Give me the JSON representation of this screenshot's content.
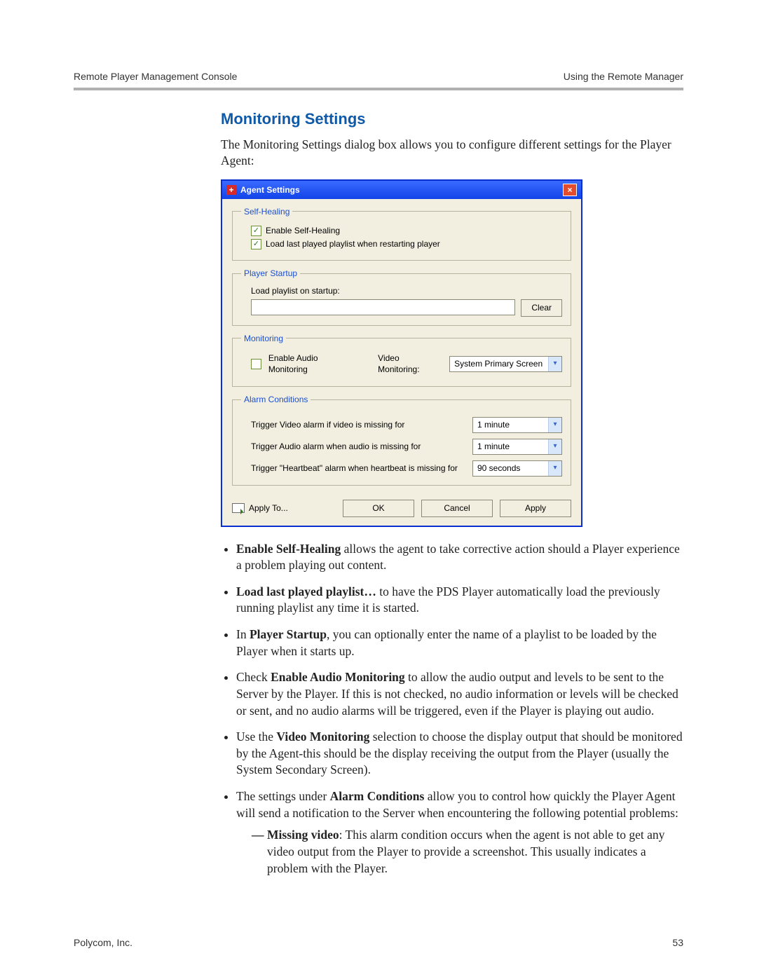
{
  "header": {
    "left": "Remote Player Management Console",
    "right": "Using the Remote Manager"
  },
  "section_title": "Monitoring Settings",
  "intro": "The Monitoring Settings dialog box allows you to configure different settings for the Player Agent:",
  "dialog": {
    "title": "Agent Settings",
    "groups": {
      "self_healing": {
        "legend": "Self-Healing",
        "enable_label": "Enable Self-Healing",
        "enable_checked": true,
        "load_last_label": "Load last played playlist when restarting player",
        "load_last_checked": true
      },
      "player_startup": {
        "legend": "Player Startup",
        "label": "Load playlist on startup:",
        "value": "",
        "clear_label": "Clear"
      },
      "monitoring": {
        "legend": "Monitoring",
        "enable_audio_label": "Enable Audio Monitoring",
        "enable_audio_checked": false,
        "video_label": "Video Monitoring:",
        "video_value": "System Primary Screen"
      },
      "alarm": {
        "legend": "Alarm Conditions",
        "video_label": "Trigger Video alarm if video is missing for",
        "video_value": "1 minute",
        "audio_label": "Trigger Audio alarm when audio is missing for",
        "audio_value": "1 minute",
        "heartbeat_label": "Trigger \"Heartbeat\" alarm when heartbeat is missing for",
        "heartbeat_value": "90 seconds"
      }
    },
    "buttons": {
      "apply_to": "Apply To...",
      "ok": "OK",
      "cancel": "Cancel",
      "apply": "Apply"
    }
  },
  "bullets": {
    "b1_a": "Enable Self-Healing",
    "b1_b": " allows the agent to take corrective action should a Player experience a problem playing out content.",
    "b2_a": "Load last played playlist…",
    "b2_b": "  to have the PDS Player automatically load the previously running playlist any time it is started.",
    "b3_a": "In ",
    "b3_b": "Player Startup",
    "b3_c": ", you can optionally enter the name of a playlist to be loaded by the Player when it starts up.",
    "b4_a": "Check ",
    "b4_b": "Enable Audio Monitoring",
    "b4_c": " to allow the audio output and levels to be sent to the Server by the Player. If this is not checked, no audio information or levels will be checked or sent, and no audio alarms will be triggered, even if the Player is playing out audio.",
    "b5_a": "Use the ",
    "b5_b": "Video Monitoring",
    "b5_c": " selection to choose the display output that should be monitored by the Agent-this should be the display receiving the output from the Player (usually the System Secondary Screen).",
    "b6_a": "The settings under ",
    "b6_b": "Alarm Conditions",
    "b6_c": " allow you to control how quickly the Player Agent will send a notification to the Server when encountering the following potential problems:",
    "sub1_a": "Missing video",
    "sub1_b": ": This alarm condition occurs when the agent is not able to get any video output from the Player to provide a screenshot. This usually indicates a problem with the Player."
  },
  "footer": {
    "left": "Polycom, Inc.",
    "right": "53"
  }
}
